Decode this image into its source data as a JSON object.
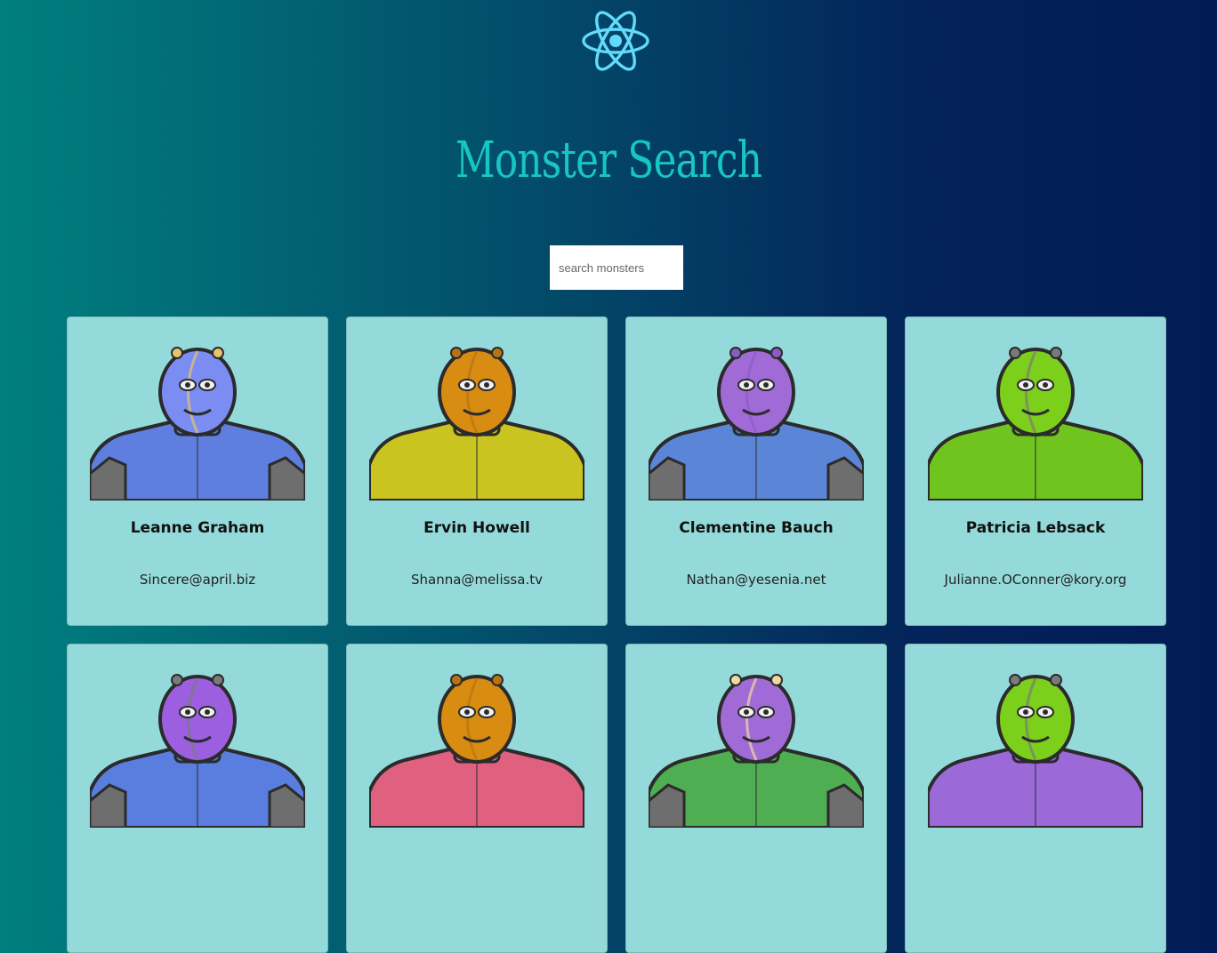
{
  "app": {
    "logo_icon": "react-atom-icon",
    "title": "Monster Search",
    "accent_color": "#16c7c1"
  },
  "search": {
    "placeholder": "search monsters",
    "value": ""
  },
  "monsters": [
    {
      "name": "Leanne Graham",
      "email": "Sincere@april.biz",
      "head": "#7b8cf2",
      "body": "#5f7fe0",
      "head2": "#e6c46a",
      "avatar_icon": "monster-avatar-icon"
    },
    {
      "name": "Ervin Howell",
      "email": "Shanna@melissa.tv",
      "head": "#d98c12",
      "body": "#c9c41f",
      "head2": "#b87410",
      "avatar_icon": "monster-avatar-icon"
    },
    {
      "name": "Clementine Bauch",
      "email": "Nathan@yesenia.net",
      "head": "#a06bd6",
      "body": "#5b86d8",
      "head2": "#8a5cc4",
      "avatar_icon": "monster-avatar-icon"
    },
    {
      "name": "Patricia Lebsack",
      "email": "Julianne.OConner@kory.org",
      "head": "#7ccf1a",
      "body": "#6fc41e",
      "head2": "#7a7a7a",
      "avatar_icon": "monster-avatar-icon"
    },
    {
      "name": "",
      "email": "",
      "head": "#9b5fe0",
      "body": "#5a7de0",
      "head2": "#7a7a7a",
      "avatar_icon": "monster-avatar-icon"
    },
    {
      "name": "",
      "email": "",
      "head": "#d98c12",
      "body": "#e0607f",
      "head2": "#b87410",
      "avatar_icon": "monster-avatar-icon"
    },
    {
      "name": "",
      "email": "",
      "head": "#a06bd6",
      "body": "#4fae52",
      "head2": "#f0d8a0",
      "avatar_icon": "monster-avatar-icon"
    },
    {
      "name": "",
      "email": "",
      "head": "#7ccf1a",
      "body": "#9b6ad8",
      "head2": "#7a7a7a",
      "avatar_icon": "monster-avatar-icon"
    }
  ]
}
